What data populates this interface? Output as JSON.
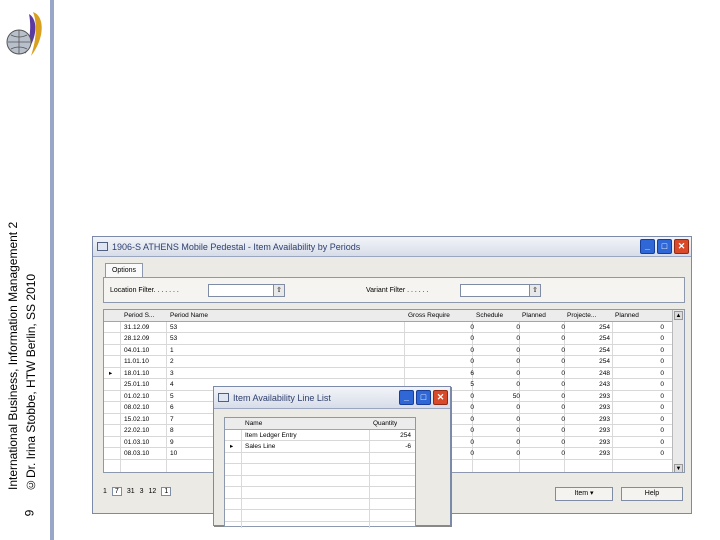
{
  "slide": {
    "course": "International Business, Information Management 2",
    "author": "©Dr. Irina Stobbe, HTW Berlin, SS 2010",
    "page": "9"
  },
  "main_window": {
    "title": "1906-S ATHENS Mobile Pedestal - Item Availability by Periods",
    "tab": "Options",
    "location_filter_label": "Location Filter. . . . . . .",
    "variant_filter_label": "Variant Filter . . . . . .",
    "columns": [
      "Period S...",
      "Period Name",
      "Gross Require",
      "Schedule",
      "Planned",
      "Projecte...",
      "Planned"
    ],
    "rows": [
      {
        "marker": "",
        "start": "31.12.09",
        "name": "53",
        "gross": "0",
        "sched": "0",
        "planned": "0",
        "proj": "254",
        "planned2": "0"
      },
      {
        "marker": "",
        "start": "28.12.09",
        "name": "53",
        "gross": "0",
        "sched": "0",
        "planned": "0",
        "proj": "254",
        "planned2": "0"
      },
      {
        "marker": "",
        "start": "04.01.10",
        "name": "1",
        "gross": "0",
        "sched": "0",
        "planned": "0",
        "proj": "254",
        "planned2": "0"
      },
      {
        "marker": "",
        "start": "11.01.10",
        "name": "2",
        "gross": "0",
        "sched": "0",
        "planned": "0",
        "proj": "254",
        "planned2": "0"
      },
      {
        "marker": "▸",
        "start": "18.01.10",
        "name": "3",
        "gross": "6",
        "sched": "0",
        "planned": "0",
        "proj": "248",
        "planned2": "0"
      },
      {
        "marker": "",
        "start": "25.01.10",
        "name": "4",
        "gross": "5",
        "sched": "0",
        "planned": "0",
        "proj": "243",
        "planned2": "0"
      },
      {
        "marker": "",
        "start": "01.02.10",
        "name": "5",
        "gross": "0",
        "sched": "50",
        "planned": "0",
        "proj": "293",
        "planned2": "0"
      },
      {
        "marker": "",
        "start": "08.02.10",
        "name": "6",
        "gross": "0",
        "sched": "0",
        "planned": "0",
        "proj": "293",
        "planned2": "0"
      },
      {
        "marker": "",
        "start": "15.02.10",
        "name": "7",
        "gross": "0",
        "sched": "0",
        "planned": "0",
        "proj": "293",
        "planned2": "0"
      },
      {
        "marker": "",
        "start": "22.02.10",
        "name": "8",
        "gross": "0",
        "sched": "0",
        "planned": "0",
        "proj": "293",
        "planned2": "0"
      },
      {
        "marker": "",
        "start": "01.03.10",
        "name": "9",
        "gross": "0",
        "sched": "0",
        "planned": "0",
        "proj": "293",
        "planned2": "0"
      },
      {
        "marker": "",
        "start": "08.03.10",
        "name": "10",
        "gross": "0",
        "sched": "0",
        "planned": "0",
        "proj": "293",
        "planned2": "0"
      }
    ],
    "nav": [
      "1",
      "7",
      "31",
      "3",
      "12",
      "1"
    ],
    "item_button": "Item",
    "help_button": "Help"
  },
  "popup": {
    "title": "Item Availability Line List",
    "columns": [
      "Name",
      "Quantity"
    ],
    "rows": [
      {
        "marker": "",
        "name": "Item Ledger Entry",
        "qty": "254"
      },
      {
        "marker": "▸",
        "name": "Sales Line",
        "qty": "-6"
      }
    ]
  }
}
